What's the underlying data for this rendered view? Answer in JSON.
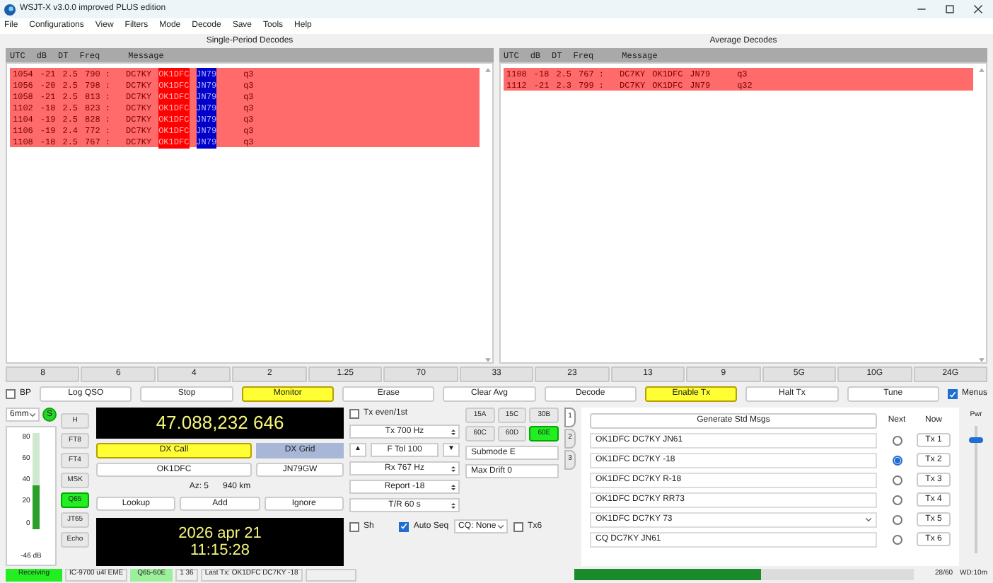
{
  "window": {
    "title": "WSJT-X   v3.0.0  improved PLUS edition"
  },
  "menu": [
    "File",
    "Configurations",
    "View",
    "Filters",
    "Mode",
    "Decode",
    "Save",
    "Tools",
    "Help"
  ],
  "panels": [
    {
      "title": "Single-Period Decodes",
      "columns": [
        "UTC",
        "dB",
        "DT",
        "Freq",
        "Message"
      ],
      "rows": [
        {
          "utc": "1054",
          "db": "-21",
          "dt": "2.5",
          "freq": "790 :",
          "call1": "DC7KY",
          "call2": "OK1DFC",
          "grid": "JN79",
          "extra": "q3",
          "highlighted": true
        },
        {
          "utc": "1056",
          "db": "-20",
          "dt": "2.5",
          "freq": "798 :",
          "call1": "DC7KY",
          "call2": "OK1DFC",
          "grid": "JN79",
          "extra": "q3",
          "highlighted": true
        },
        {
          "utc": "1058",
          "db": "-21",
          "dt": "2.5",
          "freq": "813 :",
          "call1": "DC7KY",
          "call2": "OK1DFC",
          "grid": "JN79",
          "extra": "q3",
          "highlighted": true
        },
        {
          "utc": "1102",
          "db": "-18",
          "dt": "2.5",
          "freq": "823 :",
          "call1": "DC7KY",
          "call2": "OK1DFC",
          "grid": "JN79",
          "extra": "q3",
          "highlighted": true
        },
        {
          "utc": "1104",
          "db": "-19",
          "dt": "2.5",
          "freq": "828 :",
          "call1": "DC7KY",
          "call2": "OK1DFC",
          "grid": "JN79",
          "extra": "q3",
          "highlighted": true
        },
        {
          "utc": "1106",
          "db": "-19",
          "dt": "2.4",
          "freq": "772 :",
          "call1": "DC7KY",
          "call2": "OK1DFC",
          "grid": "JN79",
          "extra": "q3",
          "highlighted": true
        },
        {
          "utc": "1108",
          "db": "-18",
          "dt": "2.5",
          "freq": "767 :",
          "call1": "DC7KY",
          "call2": "OK1DFC",
          "grid": "JN79",
          "extra": "q3",
          "highlighted": true
        }
      ]
    },
    {
      "title": "Average Decodes",
      "columns": [
        "UTC",
        "dB",
        "DT",
        "Freq",
        "Message"
      ],
      "rows": [
        {
          "utc": "1108",
          "db": "-18",
          "dt": "2.5",
          "freq": "767 :",
          "call1": "DC7KY",
          "call2": "OK1DFC",
          "grid": "JN79",
          "extra": "q3",
          "highlighted": false
        },
        {
          "utc": "1112",
          "db": "-21",
          "dt": "2.3",
          "freq": "799 :",
          "call1": "DC7KY",
          "call2": "OK1DFC",
          "grid": "JN79",
          "extra": "q32",
          "highlighted": false
        }
      ]
    }
  ],
  "bands": [
    "8",
    "6",
    "4",
    "2",
    "1.25",
    "70",
    "33",
    "23",
    "13",
    "9",
    "5G",
    "10G",
    "24G"
  ],
  "controls": [
    {
      "label": "BP",
      "kind": "checkbox",
      "checked": false
    },
    {
      "label": "Log QSO",
      "kind": "button",
      "on": false
    },
    {
      "label": "Stop",
      "kind": "button",
      "on": false
    },
    {
      "label": "Monitor",
      "kind": "button",
      "on": true
    },
    {
      "label": "Erase",
      "kind": "button",
      "on": false
    },
    {
      "label": "Clear Avg",
      "kind": "button",
      "on": false
    },
    {
      "label": "Decode",
      "kind": "button",
      "on": false
    },
    {
      "label": "Enable Tx",
      "kind": "button",
      "on": true
    },
    {
      "label": "Halt Tx",
      "kind": "button",
      "on": false
    },
    {
      "label": "Tune",
      "kind": "button",
      "on": false
    },
    {
      "label": "Menus",
      "kind": "checkbox",
      "checked": true
    }
  ],
  "band_select": "6mm",
  "sync_badge": "S",
  "meter": {
    "ticks": [
      "80",
      "60",
      "40",
      "20",
      "0"
    ],
    "level": 0.45,
    "reading": "-46 dB"
  },
  "modes": [
    {
      "label": "H",
      "selected": false
    },
    {
      "label": "FT8",
      "selected": false
    },
    {
      "label": "FT4",
      "selected": false
    },
    {
      "label": "MSK",
      "selected": false
    },
    {
      "label": "Q65",
      "selected": true
    },
    {
      "label": "JT65",
      "selected": false
    },
    {
      "label": "Echo",
      "selected": false
    }
  ],
  "frequency": "47.088,232 646",
  "dx": {
    "call_label": "DX Call",
    "grid_label": "DX Grid",
    "call": "OK1DFC",
    "grid": "JN79GW",
    "az": "Az: 5",
    "distance": "940 km"
  },
  "dx_buttons": [
    "Lookup",
    "Add",
    "Ignore"
  ],
  "clock": {
    "date": "2026 apr 21",
    "time": "11:15:28"
  },
  "tx_even": {
    "label": "Tx even/1st",
    "checked": false
  },
  "spinners": [
    {
      "kind": "spin",
      "text": "Tx  700 Hz"
    },
    {
      "kind": "tol",
      "text": "F Tol  100",
      "up": "▲",
      "down": "▼"
    },
    {
      "kind": "spin",
      "text": "Rx  767 Hz"
    },
    {
      "kind": "spin",
      "text": "Report -18"
    },
    {
      "kind": "spin",
      "text": "T/R  60 s"
    }
  ],
  "sh": {
    "label": "Sh",
    "checked": false
  },
  "auto_seq": {
    "label": "Auto Seq",
    "checked": true
  },
  "cq": "CQ: None",
  "tx6": {
    "label": "Tx6",
    "checked": false
  },
  "submodes": [
    {
      "label": "15A",
      "selected": false
    },
    {
      "label": "15C",
      "selected": false
    },
    {
      "label": "30B",
      "selected": false
    },
    {
      "label": "60C",
      "selected": false
    },
    {
      "label": "60D",
      "selected": false
    },
    {
      "label": "60E",
      "selected": true
    }
  ],
  "submode": "Submode E",
  "max_drift": "Max Drift  0",
  "tabs": [
    {
      "label": "1",
      "selected": true
    },
    {
      "label": "2",
      "selected": false
    },
    {
      "label": "3",
      "selected": false
    }
  ],
  "generate": "Generate Std Msgs",
  "next_label": "Next",
  "now_label": "Now",
  "messages": [
    {
      "text": "OK1DFC DC7KY JN61",
      "kind": "text",
      "next": false,
      "now": "Tx 1"
    },
    {
      "text": "OK1DFC DC7KY -18",
      "kind": "text",
      "next": true,
      "now": "Tx 2"
    },
    {
      "text": "OK1DFC DC7KY R-18",
      "kind": "text",
      "next": false,
      "now": "Tx 3"
    },
    {
      "text": "OK1DFC DC7KY RR73",
      "kind": "text",
      "next": false,
      "now": "Tx 4"
    },
    {
      "text": "OK1DFC DC7KY 73",
      "kind": "combo",
      "next": false,
      "now": "Tx 5"
    },
    {
      "text": "CQ DC7KY JN61",
      "kind": "text",
      "next": false,
      "now": "Tx 6"
    }
  ],
  "pwr": {
    "label": "Pwr",
    "level": 0.88
  },
  "status": {
    "state": "Receiving",
    "rig": "IC-9700 u4l EME",
    "mode": "Q65-60E",
    "count": "1  36",
    "last_tx": "Last Tx: OK1DFC DC7KY -18",
    "progress": {
      "level": 0.55
    },
    "period": "28/60",
    "wd": "WD:10m"
  }
}
